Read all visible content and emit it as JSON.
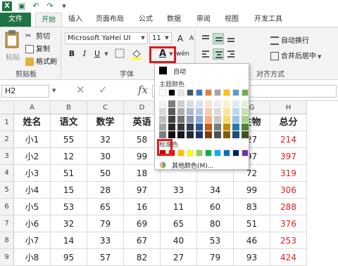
{
  "title_bar": {
    "app_icon": "X",
    "undo_glyph": "↶",
    "redo_glyph": "↷",
    "save_glyph": "▣",
    "more_glyph": "▾"
  },
  "tabs": [
    "文件",
    "开始",
    "插入",
    "页面布局",
    "公式",
    "数据",
    "审阅",
    "视图",
    "开发工具"
  ],
  "clipboard": {
    "cut": "剪切",
    "copy": "复制",
    "paste": "粘贴",
    "format_painter": "格式刷",
    "group_label": "剪贴板"
  },
  "font": {
    "name": "Microsoft YaHei UI",
    "size": "11",
    "bold": "B",
    "italic": "I",
    "underline": "U",
    "grow": "A",
    "shrink": "A",
    "wen": "wén",
    "group_label": "字体",
    "font_color_letter": "A"
  },
  "alignment": {
    "wrap_text": "自动换行",
    "merge_center": "合并后居中",
    "group_label": "对齐方式"
  },
  "formula_bar": {
    "cell_ref": "H2",
    "fx": "fx",
    "formula": "=S"
  },
  "columns": [
    "A",
    "B",
    "C",
    "D",
    "E",
    "F",
    "G",
    "H"
  ],
  "rows": [
    "1",
    "2",
    "3",
    "4",
    "5",
    "6",
    "7",
    "8",
    "9"
  ],
  "table": [
    [
      "姓名",
      "语文",
      "数学",
      "英语",
      "",
      "",
      "生物",
      "总分"
    ],
    [
      "小1",
      "55",
      "32",
      "58",
      "",
      "",
      "27",
      "214"
    ],
    [
      "小2",
      "12",
      "30",
      "99",
      "",
      "",
      "97",
      "397"
    ],
    [
      "小3",
      "51",
      "50",
      "18",
      "",
      "",
      "72",
      "319"
    ],
    [
      "小4",
      "15",
      "28",
      "97",
      "33",
      "34",
      "99",
      "306"
    ],
    [
      "小5",
      "53",
      "65",
      "16",
      "11",
      "60",
      "83",
      "288"
    ],
    [
      "小6",
      "32",
      "79",
      "69",
      "65",
      "80",
      "51",
      "376"
    ],
    [
      "小7",
      "14",
      "33",
      "67",
      "40",
      "53",
      "46",
      "253"
    ],
    [
      "小8",
      "95",
      "57",
      "82",
      "27",
      "79",
      "93",
      "424"
    ]
  ],
  "color_popup": {
    "auto_label": "自动",
    "theme_label": "主题颜色",
    "standard_label": "标准色",
    "more_colors": "其他颜色(M)...",
    "theme_top": [
      "#ffffff",
      "#000000",
      "#e7e6e6",
      "#44546a",
      "#4472c4",
      "#ed7d31",
      "#a5a5a5",
      "#ffc000",
      "#5b9bd5",
      "#70ad47"
    ],
    "theme_shades": [
      [
        "#f2f2f2",
        "#7f7f7f",
        "#d0cece",
        "#d6dce4",
        "#d9e2f3",
        "#fbe4d5",
        "#ededed",
        "#fff2cc",
        "#deebf6",
        "#e2efd9"
      ],
      [
        "#d8d8d8",
        "#595959",
        "#aeabab",
        "#adb9ca",
        "#b4c6e7",
        "#f7caac",
        "#dbdbdb",
        "#ffe598",
        "#bdd7ee",
        "#c5e0b3"
      ],
      [
        "#bfbfbf",
        "#3f3f3f",
        "#757070",
        "#8496b0",
        "#8eaadb",
        "#f4b083",
        "#c9c9c9",
        "#ffd965",
        "#9cc3e5",
        "#a8d08d"
      ],
      [
        "#a5a5a5",
        "#262626",
        "#3a3838",
        "#323f4f",
        "#2f5496",
        "#c55a11",
        "#7b7b7b",
        "#bf9000",
        "#2e75b5",
        "#538135"
      ],
      [
        "#7f7f7f",
        "#0c0c0c",
        "#171616",
        "#222a35",
        "#1f3763",
        "#833c0b",
        "#525252",
        "#7f6000",
        "#1e4e79",
        "#375623"
      ]
    ],
    "standard": [
      "#c00000",
      "#ff0000",
      "#ffc000",
      "#ffff00",
      "#92d050",
      "#00b050",
      "#00b0f0",
      "#0070c0",
      "#002060",
      "#7030a0"
    ]
  },
  "colors": {
    "excel_green": "#217346",
    "red_value": "#e02020",
    "highlight_box": "#e01b1b"
  }
}
